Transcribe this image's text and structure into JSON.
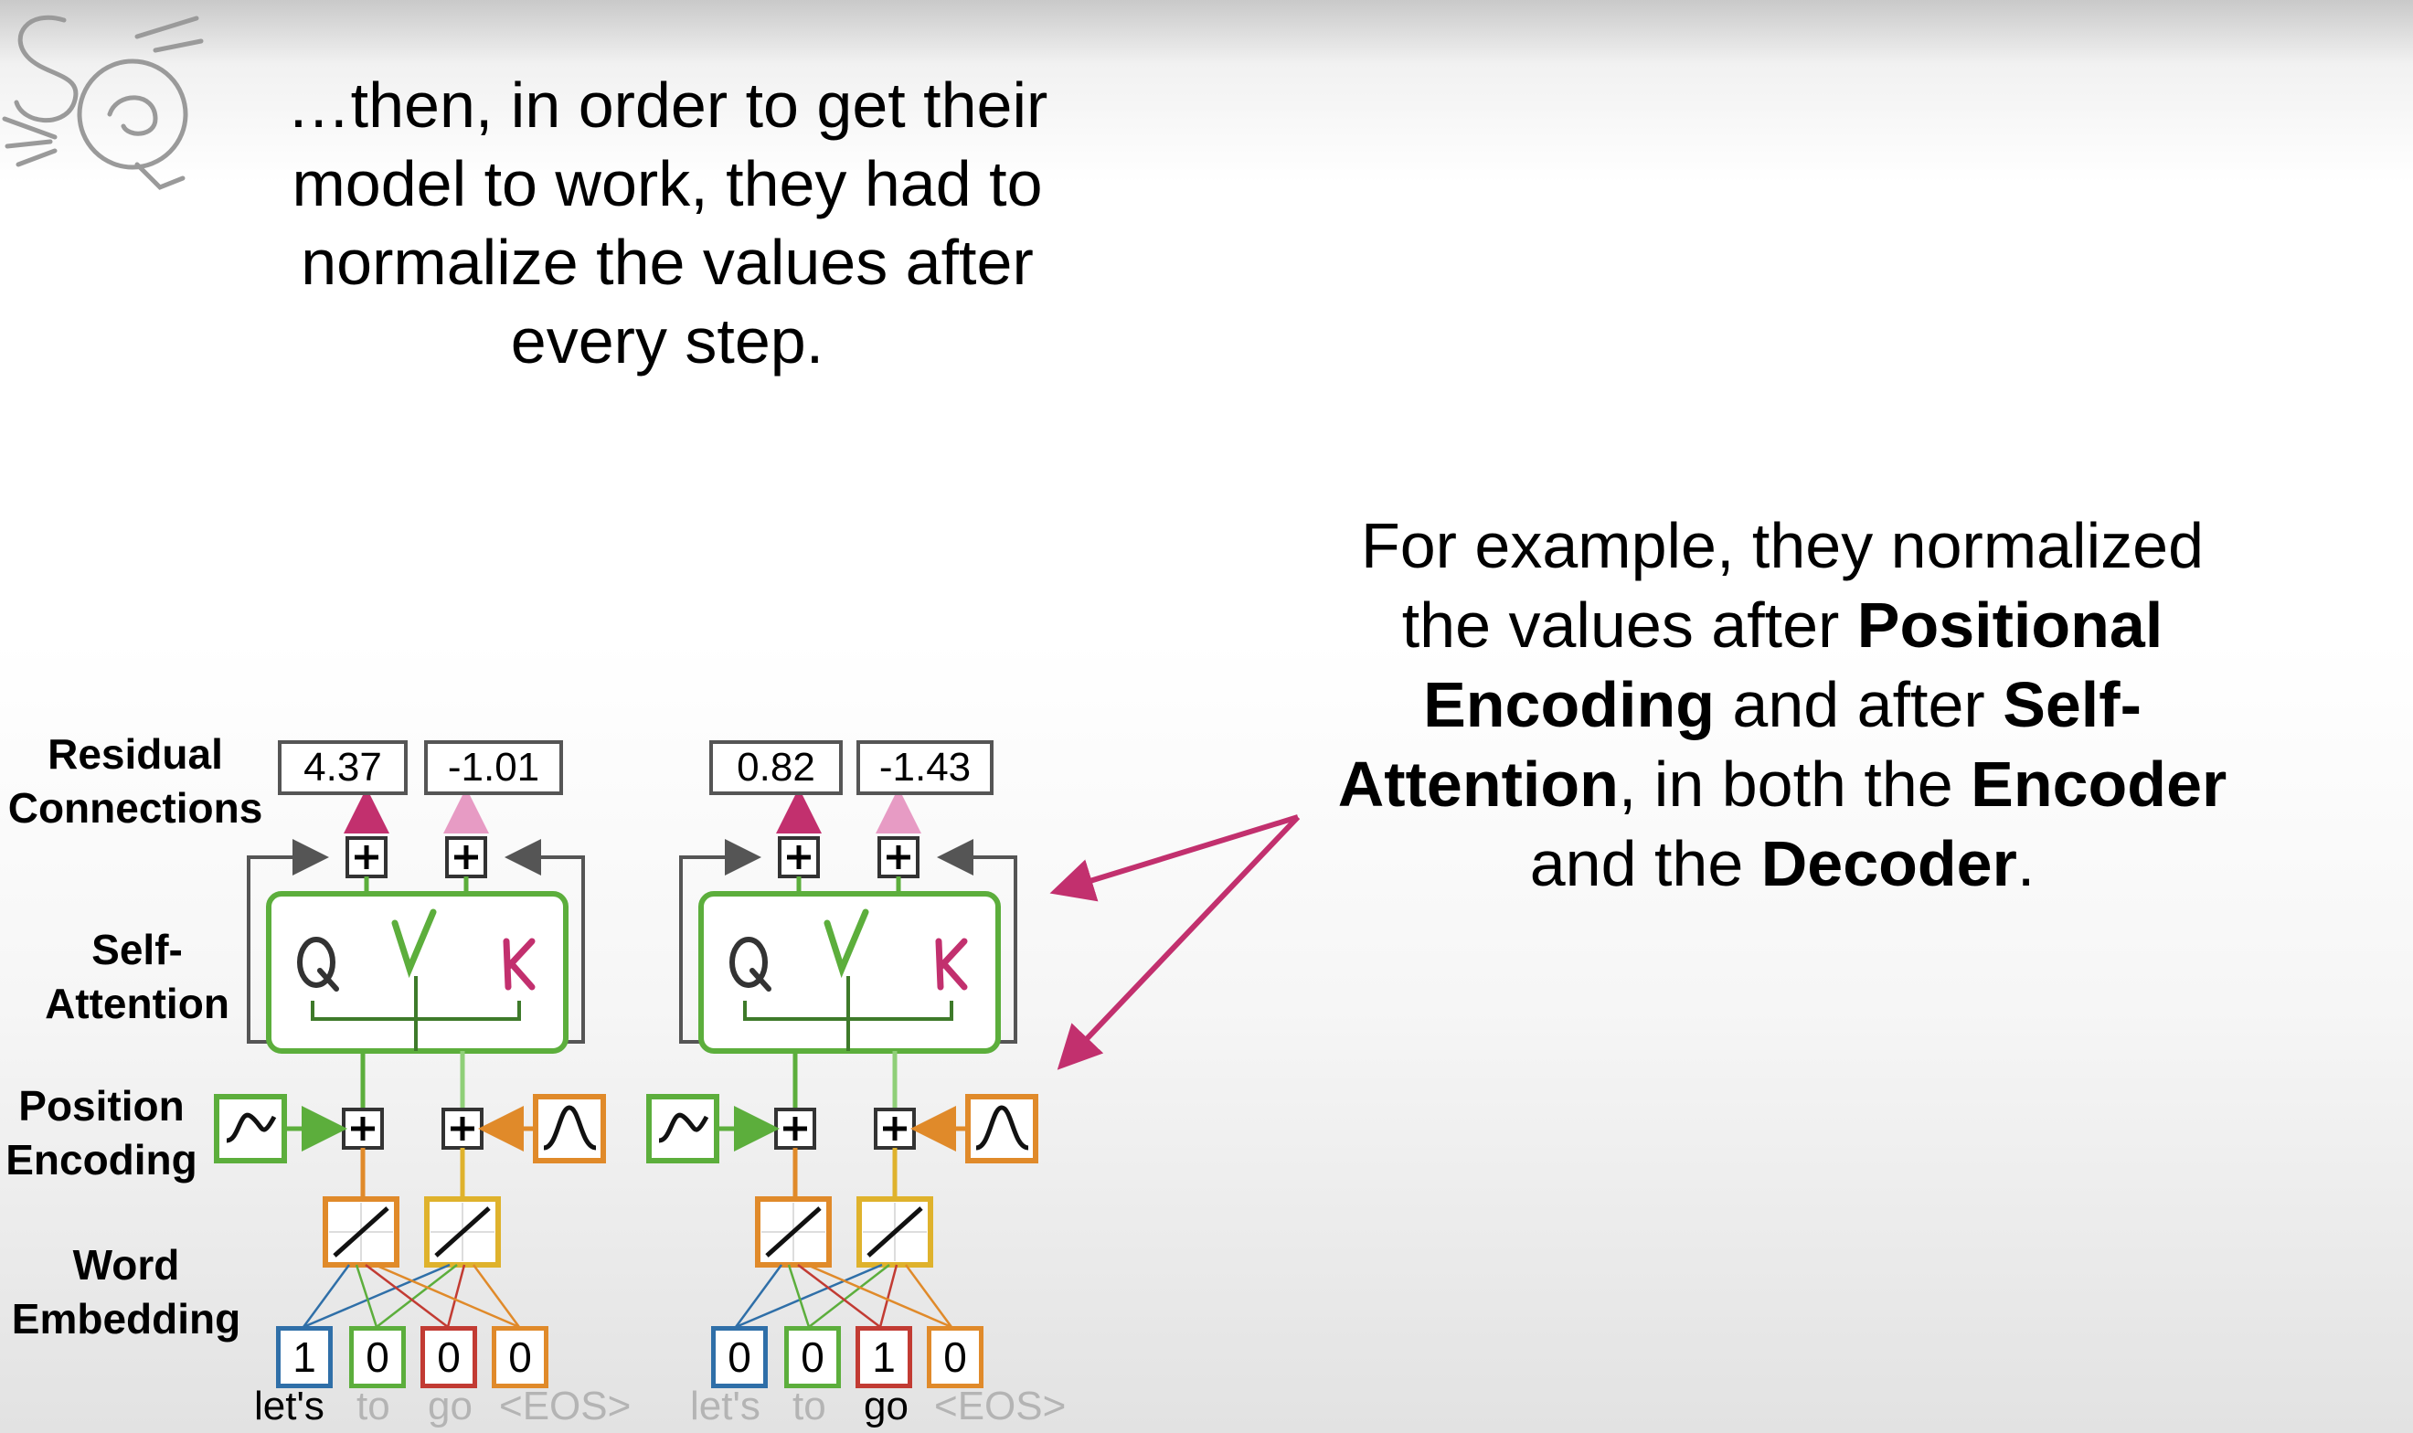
{
  "intro": {
    "line1": "…then, in order to get their",
    "line2": "model to work, they had to",
    "line3": "normalize the values after",
    "line4": "every step."
  },
  "note": {
    "l1": "For example, they normalized",
    "l2a": "the values after ",
    "l2b": "Positional",
    "l3a": "Encoding",
    "l3b": " and after ",
    "l3c": "Self-",
    "l4a": "Attention",
    "l4b": ", in both the ",
    "l4c": "Encoder",
    "l5a": "and the ",
    "l5b": "Decoder",
    "l5c": "."
  },
  "labels": {
    "residual_1": "Residual",
    "residual_2": "Connections",
    "self_1": "Self-",
    "self_2": "Attention",
    "pos_1": "Position",
    "pos_2": "Encoding",
    "word_1": "Word",
    "word_2": "Embedding"
  },
  "blocks": [
    {
      "outputs": [
        "4.37",
        "-1.01"
      ],
      "onehot": [
        "1",
        "0",
        "0",
        "0"
      ],
      "tokens": [
        "let's",
        "to",
        "go",
        "<EOS>"
      ],
      "active_token": 0
    },
    {
      "outputs": [
        "0.82",
        "-1.43"
      ],
      "onehot": [
        "0",
        "0",
        "1",
        "0"
      ],
      "tokens": [
        "let's",
        "to",
        "go",
        "<EOS>"
      ],
      "active_token": 2
    }
  ],
  "attention_letters": [
    "Q",
    "V",
    "K"
  ],
  "colors": {
    "green": "#5cae3c",
    "magenta": "#c2306e",
    "pink": "#e79bc4",
    "orange": "#e08a2a",
    "yellow": "#dfb22c",
    "blue": "#2f6fa8",
    "red": "#c23b33",
    "gray_box": "#555555"
  },
  "icons": [
    "add-icon",
    "sine-wave-icon",
    "bell-curve-icon",
    "linear-embedding-icon",
    "arrow-icon",
    "logo-sq-icon"
  ]
}
